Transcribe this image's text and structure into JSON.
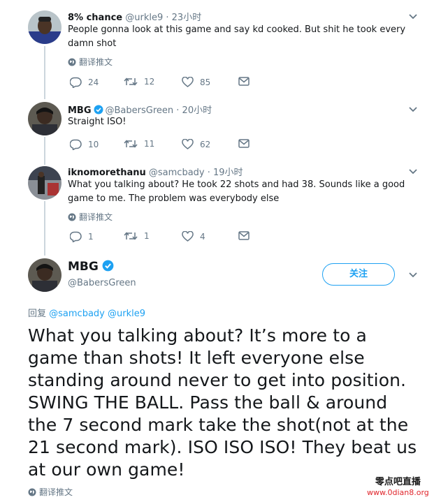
{
  "tweets": [
    {
      "name": "8% chance",
      "handle": "@urkle9",
      "time": "· 23小时",
      "text": "People gonna look at this game and say kd cooked. But shit he took every damn shot",
      "translate": "翻译推文",
      "replies": "24",
      "retweets": "12",
      "likes": "85"
    },
    {
      "name": "MBG",
      "handle": "@BabersGreen",
      "time": "· 20小时",
      "text": "Straight ISO!",
      "replies": "10",
      "retweets": "11",
      "likes": "62"
    },
    {
      "name": "iknomorethanu",
      "handle": "@samcbady",
      "time": "· 19小时",
      "text": "What you talking about? He took 22 shots and had 38. Sounds like a good game to me. The problem was everybody else",
      "translate": "翻译推文",
      "replies": "1",
      "retweets": "1",
      "likes": "4"
    }
  ],
  "main_tweet": {
    "name": "MBG",
    "handle": "@BabersGreen",
    "follow_label": "关注",
    "reply_prefix": "回复",
    "reply_mention_1": "@samcbady",
    "reply_mention_2": "@urkle9",
    "text": "What you talking about? It’s more to a game than shots! It left everyone else standing around never to get into position. SWING THE BALL. Pass the ball & around the 7 second mark take the shot(not at the 21 second mark). ISO ISO ISO! They beat us at our own game!",
    "translate": "翻译推文"
  },
  "watermark": {
    "line1": "零点吧直播",
    "line2": "www.0dian8.org"
  },
  "colors": {
    "accent": "#1da1f2",
    "muted": "#657786",
    "watermark_red": "#e0262c"
  }
}
